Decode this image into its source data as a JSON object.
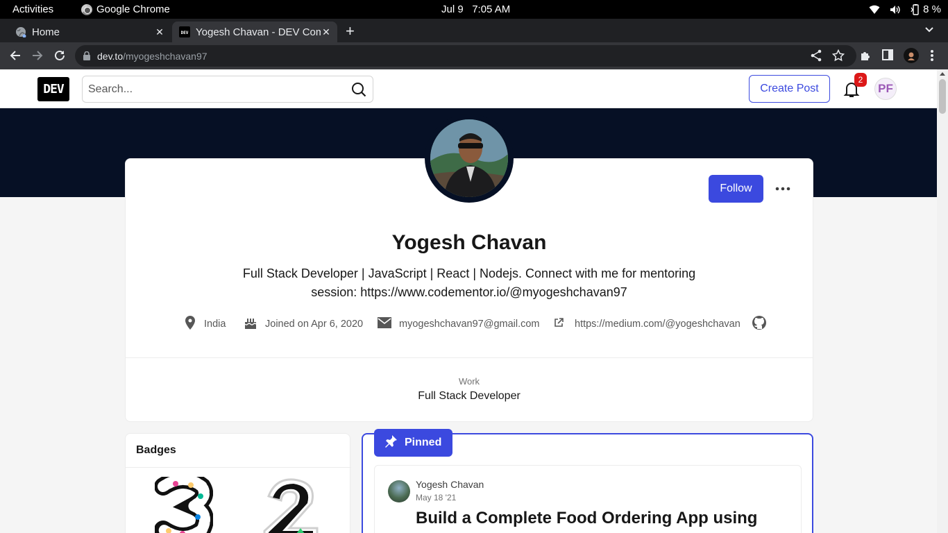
{
  "os": {
    "activities": "Activities",
    "app_name": "Google Chrome",
    "date": "Jul 9",
    "time": "7:05 AM",
    "battery": "8 %"
  },
  "browser": {
    "tabs": [
      {
        "label": "Home",
        "active": false
      },
      {
        "label": "Yogesh Chavan - DEV Community",
        "active": true
      }
    ],
    "url_host": "dev.to",
    "url_path": "/myogeshchavan97"
  },
  "site": {
    "logo": "DEV",
    "search_placeholder": "Search...",
    "create_post": "Create Post",
    "notification_count": "2",
    "user_initials": "PF"
  },
  "profile": {
    "follow_label": "Follow",
    "name": "Yogesh Chavan",
    "bio_line1": "Full Stack Developer | JavaScript | React | Nodejs. Connect with me for mentoring",
    "bio_line2": "session: https://www.codementor.io/@myogeshchavan97",
    "location": "India",
    "joined": "Joined on Apr 6, 2020",
    "email": "myogeshchavan97@gmail.com",
    "website": "https://medium.com/@yogeshchavan",
    "work_label": "Work",
    "work_value": "Full Stack Developer"
  },
  "badges": {
    "title": "Badges"
  },
  "pinned": {
    "label": "Pinned",
    "author": "Yogesh Chavan",
    "date": "May 18 '21",
    "title": "Build a Complete Food Ordering App using"
  },
  "colors": {
    "accent": "#3b49df",
    "banner": "#061025",
    "badge_red": "#dc1818"
  }
}
